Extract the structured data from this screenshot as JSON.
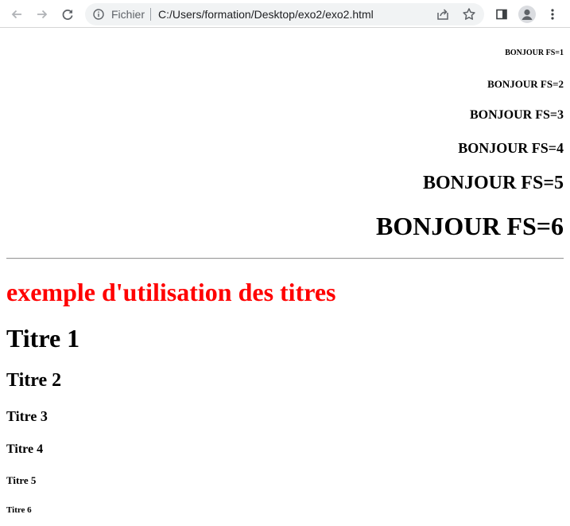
{
  "browser": {
    "scheme_label": "Fichier",
    "url": "C:/Users/formation/Desktop/exo2/exo2.html"
  },
  "page": {
    "font_samples": [
      "BONJOUR FS=1",
      "BONJOUR FS=2",
      "BONJOUR FS=3",
      "BONJOUR FS=4",
      "BONJOUR FS=5",
      "BONJOUR FS=6"
    ],
    "headings_title": "exemple d'utilisation des titres",
    "headings_title_color": "#ff0000",
    "headings": [
      "Titre 1",
      "Titre 2",
      "Titre 3",
      "Titre 4",
      "Titre 5",
      "Titre 6"
    ]
  }
}
